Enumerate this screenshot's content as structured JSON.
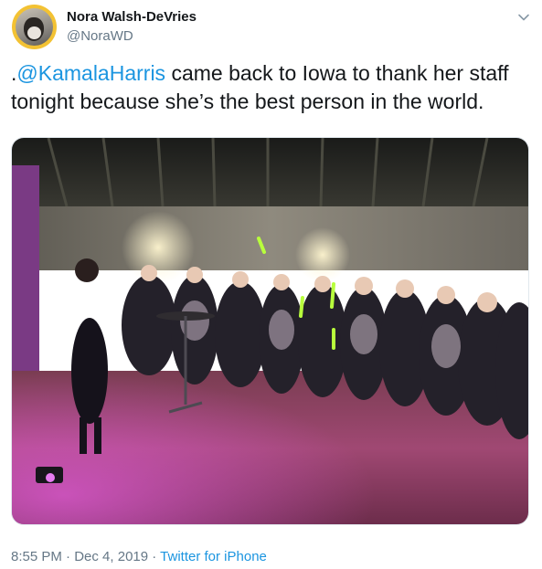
{
  "author": {
    "name": "Nora Walsh-DeVries",
    "handle": "@NoraWD"
  },
  "tweet": {
    "prefix": ".",
    "mention": "@KamalaHarris",
    "body_line1": " came back to Iowa to thank her staff",
    "body_line2": "tonight because she’s the best person in the world."
  },
  "meta": {
    "time": "8:55 PM",
    "sep1": " · ",
    "date": "Dec 4, 2019",
    "sep2": " · ",
    "source": "Twitter for iPhone"
  },
  "icons": {
    "menu": "chevron-down-icon",
    "avatar": "dog-avatar"
  },
  "colors": {
    "link": "#1b95e0",
    "secondary": "#657786",
    "text": "#14171a",
    "avatar_ring": "#f3c233"
  }
}
